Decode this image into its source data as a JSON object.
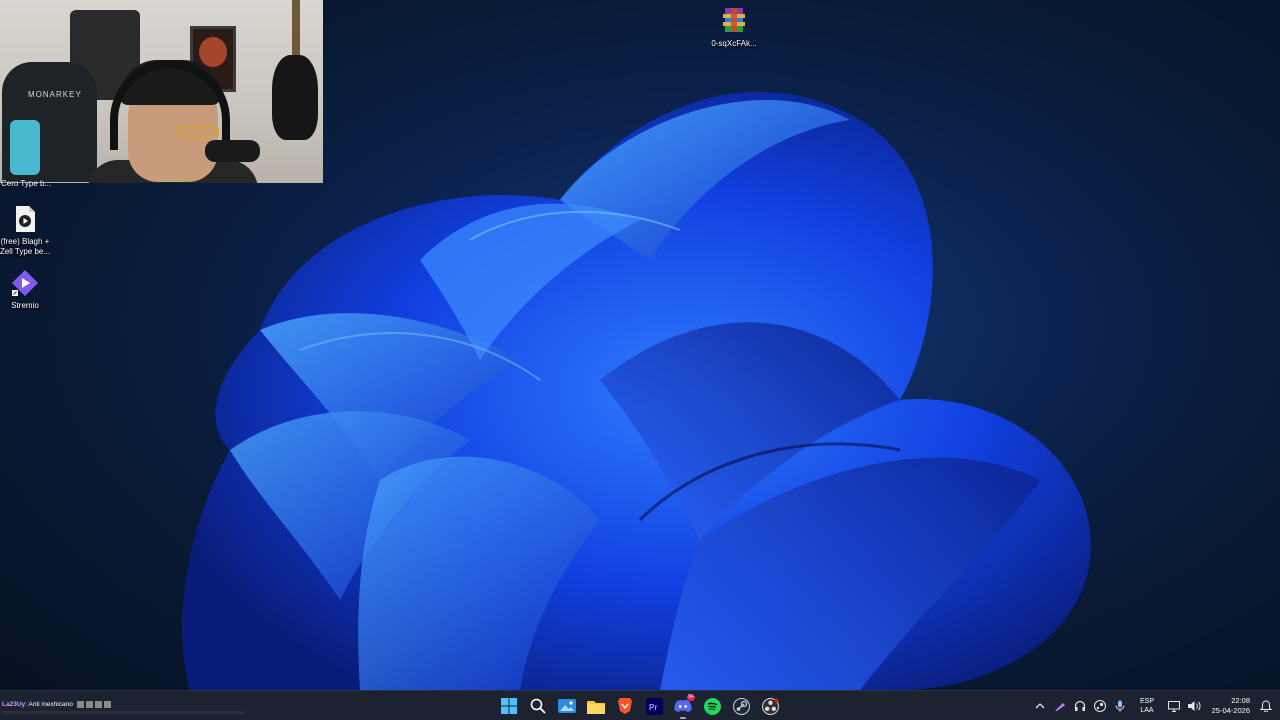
{
  "desktop": {
    "icons": [
      {
        "label": "0-sqXcFAk..."
      },
      {
        "label": "(free) Blagh +\nZell Type be..."
      },
      {
        "label": "Stremio"
      }
    ],
    "partial_label": "Cero Type b..."
  },
  "webcam": {
    "chair_brand": "MONARKEY"
  },
  "chat": {
    "user": "La23Uy",
    "message": ": Anti mexhicano"
  },
  "taskbar": {
    "apps": [
      {
        "name": "start-button"
      },
      {
        "name": "search-button"
      },
      {
        "name": "photos"
      },
      {
        "name": "file-explorer"
      },
      {
        "name": "brave"
      },
      {
        "name": "premiere-pro"
      },
      {
        "name": "discord"
      },
      {
        "name": "spotify"
      },
      {
        "name": "steam"
      },
      {
        "name": "obs"
      }
    ],
    "discord_badge": "9+",
    "language": {
      "line1": "ESP",
      "line2": "LAA"
    },
    "clock": {
      "time": "22:08",
      "date": "25-04-2026"
    }
  },
  "colors": {
    "taskbar": "#1c2230",
    "accent": "#1f6fff"
  }
}
